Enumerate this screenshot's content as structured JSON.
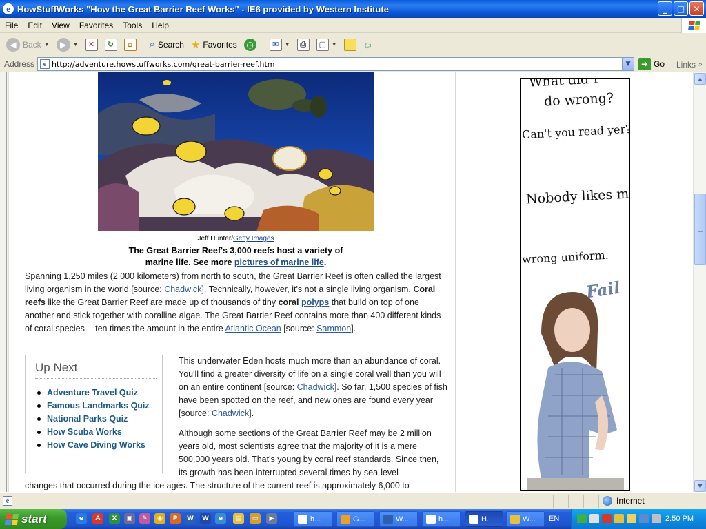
{
  "window": {
    "title": "HowStuffWorks \"How the Great Barrier Reef Works\" - IE6 provided by Western Institute",
    "min": "_",
    "max": "□",
    "close": "✕"
  },
  "menu": [
    "File",
    "Edit",
    "View",
    "Favorites",
    "Tools",
    "Help"
  ],
  "toolbar": {
    "back": "Back",
    "search": "Search",
    "favorites": "Favorites"
  },
  "address": {
    "label": "Address",
    "url": "http://adventure.howstuffworks.com/great-barrier-reef.htm",
    "go": "Go",
    "links": "Links"
  },
  "article": {
    "photo_credit_name": "Jeff Hunter/",
    "photo_credit_link": "Getty Images",
    "caption_line1": "The Great Barrier Reef's 3,000 reefs host a variety of",
    "caption_line2_pre": "marine life. See more ",
    "caption_link": "pictures of marine life",
    "caption_end": ".",
    "p1": {
      "t1": "Spanning 1,250 miles (2,000 kilometers) from north to south, the Great Barrier Reef is often called the largest living organism in the world [source: ",
      "l1": "Chadwick",
      "t2": "]. Technically, however, it's not a single living organism. ",
      "b1": "Coral reefs",
      "t3": " like the Great Barrier Reef are made up of thousands of tiny ",
      "b2": "coral",
      "t4": " ",
      "l2": "polyps",
      "t5": " that build on top of one another and stick together with coralline algae. The Great Barrier Reef contains more than 400 different kinds of coral species -- ten times the amount in the entire ",
      "l3": "Atlantic Ocean",
      "t6": " [source: ",
      "l4": "Sammon",
      "t7": "]."
    },
    "p2": {
      "t1": "This underwater Eden hosts much more than an abundance of coral. You'll find a greater diversity of life on a single coral wall than you will on an entire continent [source: ",
      "l1": "Chadwick",
      "t2": "]. So far, 1,500 species of fish have been spotted on the reef, and new ones are found every year [source: ",
      "l2": "Chadwick",
      "t3": "]."
    },
    "p3": "Although some sections of the Great Barrier Reef may be 2 million years old, most scientists agree that the majority of it is a mere 500,000 years old. That's young by coral reef standards. Since then, its growth has been interrupted several times by sea-level",
    "p3_tail": "changes that occurred during the ice ages. The structure of the current reef is approximately 6,000 to"
  },
  "upnext": {
    "title": "Up Next",
    "items": [
      "Adventure Travel Quiz",
      "Famous Landmarks Quiz",
      "National Parks Quiz",
      "How Scuba Works",
      "How Cave Diving Works"
    ]
  },
  "ad": {
    "line1": "What did I",
    "line2": "do wrong?",
    "line3": "Can't you read yer?",
    "line4": "Nobody likes me.",
    "line5": "wrong uniform.",
    "fail": "Fail"
  },
  "status": {
    "zone": "Internet"
  },
  "taskbar": {
    "start": "start",
    "tasks": [
      "h...",
      "G...",
      "W...",
      "h...",
      "H...",
      "W..."
    ],
    "lang": "EN",
    "clock": "2:50 PM"
  }
}
